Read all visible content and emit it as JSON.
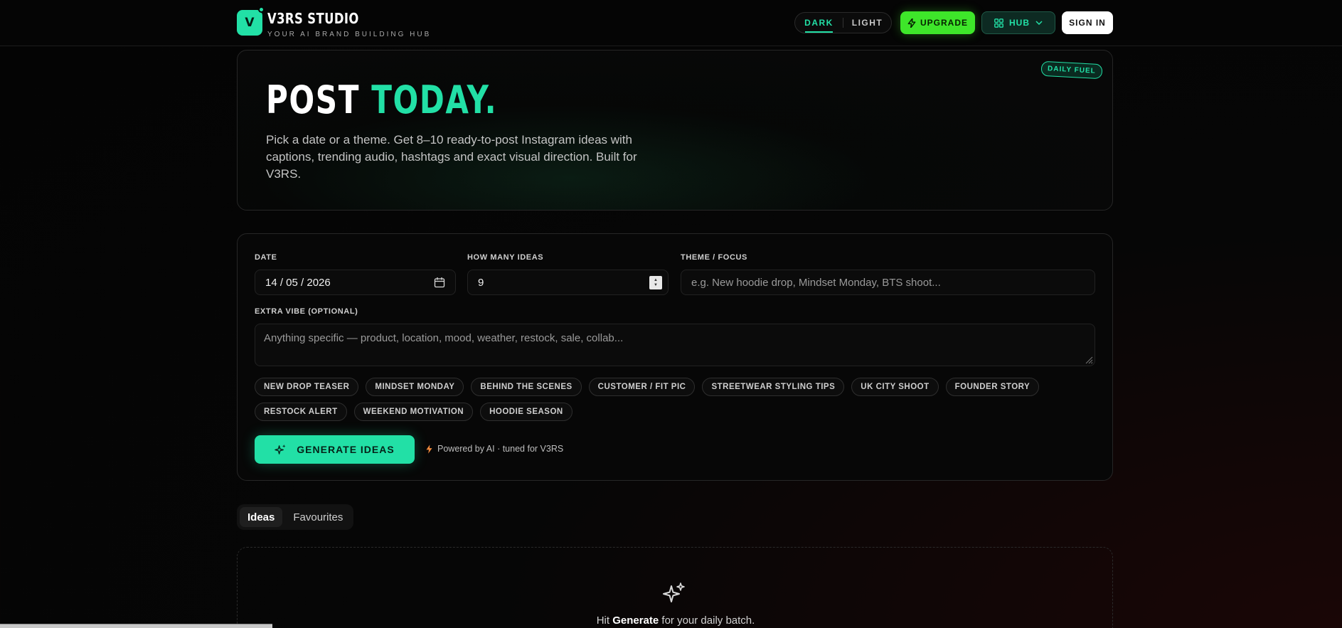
{
  "header": {
    "logo_letter": "V",
    "brand_title": "V3RS STUDIO",
    "brand_subtitle": "YOUR AI BRAND BUILDING HUB",
    "theme_dark": "DARK",
    "theme_light": "LIGHT",
    "upgrade_label": "UPGRADE",
    "hub_label": "HUB",
    "signin_label": "SIGN IN"
  },
  "hero": {
    "title_part1": "POST ",
    "title_part2": "TODAY.",
    "description": "Pick a date or a theme. Get 8–10 ready-to-post Instagram ideas with captions, trending audio, hashtags and exact visual direction. Built for V3RS.",
    "badge": "DAILY FUEL"
  },
  "form": {
    "date_label": "DATE",
    "date_value": "14 / 05 / 2026",
    "count_label": "HOW MANY IDEAS",
    "count_value": "9",
    "theme_label": "THEME / FOCUS",
    "theme_placeholder": "e.g. New hoodie drop, Mindset Monday, BTS shoot...",
    "vibe_label": "EXTRA VIBE (OPTIONAL)",
    "vibe_placeholder": "Anything specific — product, location, mood, weather, restock, sale, collab...",
    "chips_row1": [
      "NEW DROP TEASER",
      "MINDSET MONDAY",
      "BEHIND THE SCENES",
      "CUSTOMER / FIT PIC",
      "STREETWEAR STYLING TIPS",
      "UK CITY SHOOT",
      "FOUNDER STORY"
    ],
    "chips_row2": [
      "RESTOCK ALERT",
      "WEEKEND MOTIVATION",
      "HOODIE SEASON"
    ],
    "generate_label": "GENERATE IDEAS",
    "powered_text": "Powered by AI · tuned for V3RS"
  },
  "tabs": {
    "ideas": "Ideas",
    "favourites": "Favourites"
  },
  "empty": {
    "prefix": "Hit ",
    "bold": "Generate",
    "suffix": " for your daily batch."
  },
  "colors": {
    "accent": "#22e0a6",
    "upgrade": "#3ee62a",
    "background": "#050505"
  }
}
